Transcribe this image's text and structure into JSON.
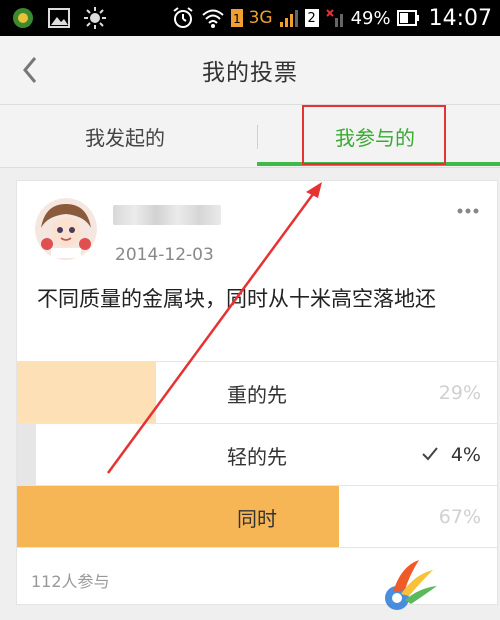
{
  "status_bar": {
    "network": "3G",
    "sim2": "2",
    "battery": "49%",
    "time": "14:07"
  },
  "header": {
    "title": "我的投票"
  },
  "tabs": [
    {
      "label": "我发起的",
      "active": false
    },
    {
      "label": "我参与的",
      "active": true
    }
  ],
  "post": {
    "date": "2014-12-03",
    "question": "不同质量的金属块，同时从十米高空落地还",
    "options": [
      {
        "label": "重的先",
        "percent": "29%",
        "fraction": 0.29,
        "selected": false,
        "fill": "#fde0b6"
      },
      {
        "label": "轻的先",
        "percent": "4%",
        "fraction": 0.04,
        "selected": true,
        "fill": "#e6e6e6"
      },
      {
        "label": "同时",
        "percent": "67%",
        "fraction": 0.67,
        "selected": false,
        "fill": "#f7b655"
      }
    ],
    "participants": "112人参与"
  },
  "colors": {
    "accent": "#3aaa35",
    "annotation": "#e53333"
  }
}
